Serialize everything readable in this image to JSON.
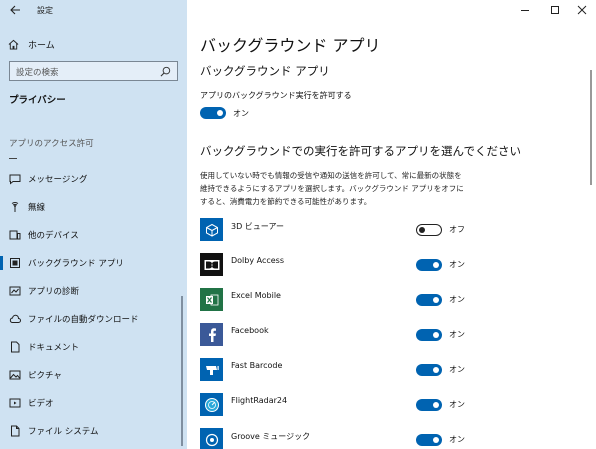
{
  "window": {
    "title": "設定"
  },
  "sidebar": {
    "home_label": "ホーム",
    "search_placeholder": "設定の検索",
    "privacy_heading": "プライバシー",
    "section_label": "アプリのアクセス許可",
    "items": [
      {
        "label": "メッセージング",
        "icon": "message-icon"
      },
      {
        "label": "無線",
        "icon": "radio-icon"
      },
      {
        "label": "他のデバイス",
        "icon": "devices-icon"
      },
      {
        "label": "バックグラウンド アプリ",
        "icon": "background-apps-icon",
        "active": true
      },
      {
        "label": "アプリの診断",
        "icon": "diagnostics-icon"
      },
      {
        "label": "ファイルの自動ダウンロード",
        "icon": "cloud-icon"
      },
      {
        "label": "ドキュメント",
        "icon": "document-icon"
      },
      {
        "label": "ピクチャ",
        "icon": "picture-icon"
      },
      {
        "label": "ビデオ",
        "icon": "video-icon"
      },
      {
        "label": "ファイル システム",
        "icon": "file-system-icon"
      }
    ]
  },
  "main": {
    "page_title": "バックグラウンド アプリ",
    "sub_title": "バックグラウンド アプリ",
    "allow_label": "アプリのバックグラウンド実行を許可する",
    "allow_state": "オン",
    "choose_heading": "バックグラウンドでの実行を許可するアプリを選んでください",
    "description": "使用していない時でも情報の受信や通知の送信を許可して、常に最新の状態を維持できるようにするアプリを選択します。バックグラウンド アプリをオフにすると、消費電力を節約できる可能性があります。",
    "apps": [
      {
        "name": "3D ビューアー",
        "state": "オフ",
        "on": false,
        "icon": "3d-viewer-icon",
        "color": "#0063b1"
      },
      {
        "name": "Dolby Access",
        "state": "オン",
        "on": true,
        "icon": "dolby-icon",
        "color": "#111111"
      },
      {
        "name": "Excel Mobile",
        "state": "オン",
        "on": true,
        "icon": "excel-icon",
        "color": "#217346"
      },
      {
        "name": "Facebook",
        "state": "オン",
        "on": true,
        "icon": "facebook-icon",
        "color": "#3b5998"
      },
      {
        "name": "Fast Barcode",
        "state": "オン",
        "on": true,
        "icon": "barcode-icon",
        "color": "#0063b1"
      },
      {
        "name": "FlightRadar24",
        "state": "オン",
        "on": true,
        "icon": "flightradar-icon",
        "color": "#0063b1"
      },
      {
        "name": "Groove ミュージック",
        "state": "オン",
        "on": true,
        "icon": "groove-icon",
        "color": "#0063b1"
      }
    ]
  },
  "colors": {
    "accent": "#0063b1",
    "sidebar_bg": "#cfe2f2"
  }
}
